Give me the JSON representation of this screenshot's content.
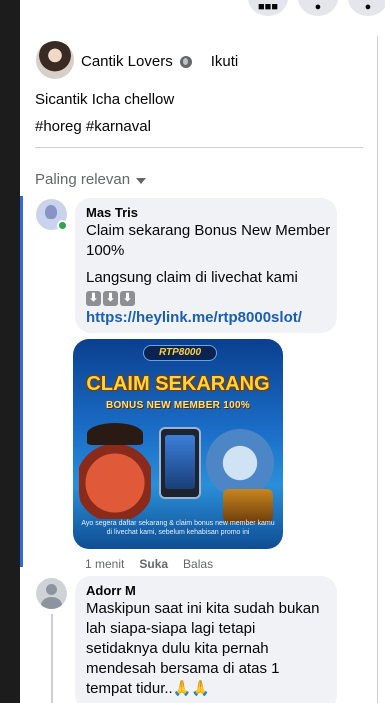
{
  "post": {
    "author": "Cantik Lovers",
    "privacy_icon": "globe-icon",
    "follow_label": "Ikuti",
    "caption": "Sicantik Icha chellow",
    "hashtags": "#horeg #karnaval"
  },
  "comments_filter": {
    "label": "Paling relevan",
    "icon": "caret-down-icon"
  },
  "comments": [
    {
      "author": "Mas Tris",
      "line1": "Claim sekarang Bonus New Member",
      "line2": "100%",
      "line3": "Langsung claim di livechat kami",
      "arrows": [
        "⬇",
        "⬇",
        "⬇"
      ],
      "link": "https://heylink.me/rtp8000slot/",
      "image": {
        "logo_text": "RTP8000",
        "title": "CLAIM SEKARANG",
        "subtitle": "BONUS NEW MEMBER 100%",
        "footer": "Ayo segera daftar sekarang & claim bonus new member kamu di livechat kami, sebelum kehabisan promo ini"
      },
      "time": "1 menit",
      "like_label": "Suka",
      "reply_label": "Balas",
      "online": true
    },
    {
      "author": "Adorr M",
      "lines": [
        "Maskipun saat ini kita sudah bukan",
        "lah siapa-siapa lagi tetapi",
        "setidaknya dulu kita pernah",
        "mendesah bersama di atas 1",
        "tempat tidur..🙏🙏"
      ]
    }
  ],
  "colors": {
    "accent": "#2d6ae3",
    "link": "#1a5fb4",
    "bubble": "#f0f2f5",
    "online": "#31a24c"
  }
}
